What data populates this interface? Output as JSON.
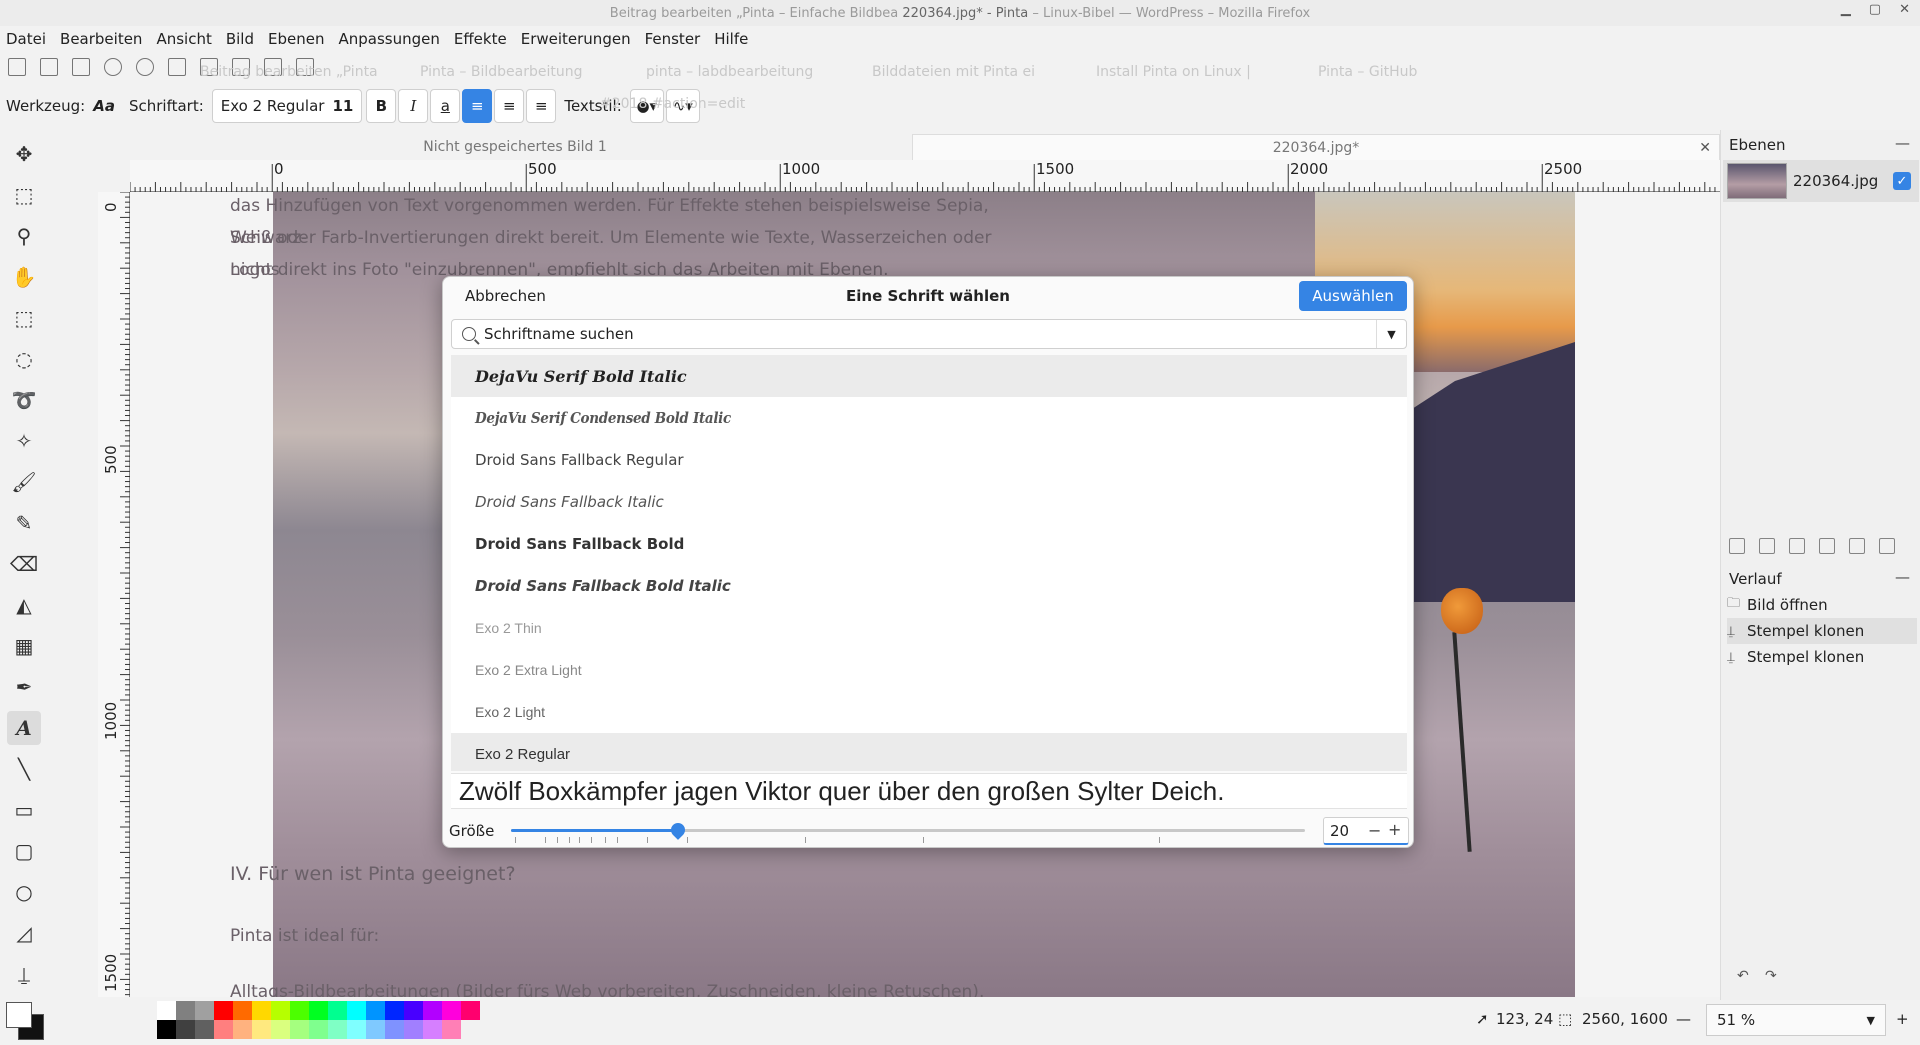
{
  "window": {
    "title_prefix": "Beitrag bearbeiten „Pinta – Einfache Bildbea",
    "title_main": "220364.jpg* - Pinta",
    "title_suffix": "– Linux-Bibel — WordPress – Mozilla Firefox"
  },
  "menu": [
    "Datei",
    "Bearbeiten",
    "Ansicht",
    "Bild",
    "Ebenen",
    "Anpassungen",
    "Effekte",
    "Erweiterungen",
    "Fenster",
    "Hilfe"
  ],
  "ghost_browser_tabs": [
    "Beitrag bearbeiten „Pinta",
    "Pinta – Bildbearbeitung",
    "pinta – labdbearbeitung",
    "Bilddateien mit Pinta ei",
    "Install Pinta on Linux |",
    "Pinta – GitHub"
  ],
  "text_toolbar": {
    "tool_label": "Werkzeug:",
    "font_label": "Schriftart:",
    "font_name": "Exo 2 Regular",
    "font_size": "11",
    "bold": "B",
    "italic": "I",
    "underline": "a",
    "style_label": "Textstil:",
    "ghost_text": "#2018 #action=edit"
  },
  "image_tabs": {
    "tab1": "Nicht gespeichertes Bild 1",
    "tab2": "220364.jpg*",
    "close": "✕"
  },
  "ruler": {
    "h": [
      "0",
      "500",
      "1000",
      "1500",
      "2000",
      "2500"
    ],
    "v": [
      "0",
      "500",
      "1000",
      "1500"
    ]
  },
  "background_text": {
    "p1": "das Hinzufügen von Text vorgenommen werden. Für Effekte stehen beispielsweise Sepia, Schwarz-",
    "p2": "Weiß oder Farb-Invertierungen direkt bereit. Um Elemente wie Texte, Wasserzeichen oder Logos",
    "p3": "nicht direkt ins Foto \"einzubrennen\", empfiehlt sich das Arbeiten mit Ebenen.",
    "h": "IV. Für wen ist Pinta geeignet?",
    "p4": "Pinta ist ideal für:",
    "p5": "Alltags-Bildbearbeitungen (Bilder fürs Web vorbereiten, Zuschneiden, kleine Retuschen)."
  },
  "dialog": {
    "cancel": "Abbrechen",
    "title": "Eine Schrift wählen",
    "select": "Auswählen",
    "search_placeholder": "Schriftname suchen",
    "fonts": [
      "DejaVu Serif Bold Italic",
      "DejaVu Serif Condensed Bold Italic",
      "Droid Sans Fallback Regular",
      "Droid Sans Fallback Italic",
      "Droid Sans Fallback Bold",
      "Droid Sans Fallback Bold Italic",
      "Exo 2 Thin",
      "Exo 2 Extra Light",
      "Exo 2 Light",
      "Exo 2 Regular"
    ],
    "preview_text": "Zwölf Boxkämpfer jagen Viktor quer über den großen Sylter Deich.",
    "size_label": "Größe",
    "size_value": "20",
    "size_fraction": 0.21
  },
  "dock": {
    "layers_header": "Ebenen",
    "layer_name": "220364.jpg",
    "history_header": "Verlauf",
    "history": [
      "Bild öffnen",
      "Stempel klonen",
      "Stempel klonen"
    ],
    "minus": "—"
  },
  "status": {
    "cursor": "123, 24",
    "size": "2560, 1600",
    "zoom": "51 %",
    "minus": "—",
    "plus": "+"
  },
  "palette": [
    "#ffffff",
    "#808080",
    "#a0a0a0",
    "#ff0000",
    "#ff6a00",
    "#ffd800",
    "#b6ff00",
    "#4cff00",
    "#00ff21",
    "#00ff90",
    "#00ffff",
    "#0094ff",
    "#0026ff",
    "#4800ff",
    "#b200ff",
    "#ff00dc",
    "#ff006e",
    "#000000",
    "#404040",
    "#606060",
    "#ff7f7f",
    "#ffb27f",
    "#ffe97f",
    "#daff7f",
    "#a5ff7f",
    "#7fff8e",
    "#7fffc5",
    "#7fffff",
    "#7fc9ff",
    "#7f92ff",
    "#a17fff",
    "#d67fff",
    "#ff7fb6"
  ]
}
